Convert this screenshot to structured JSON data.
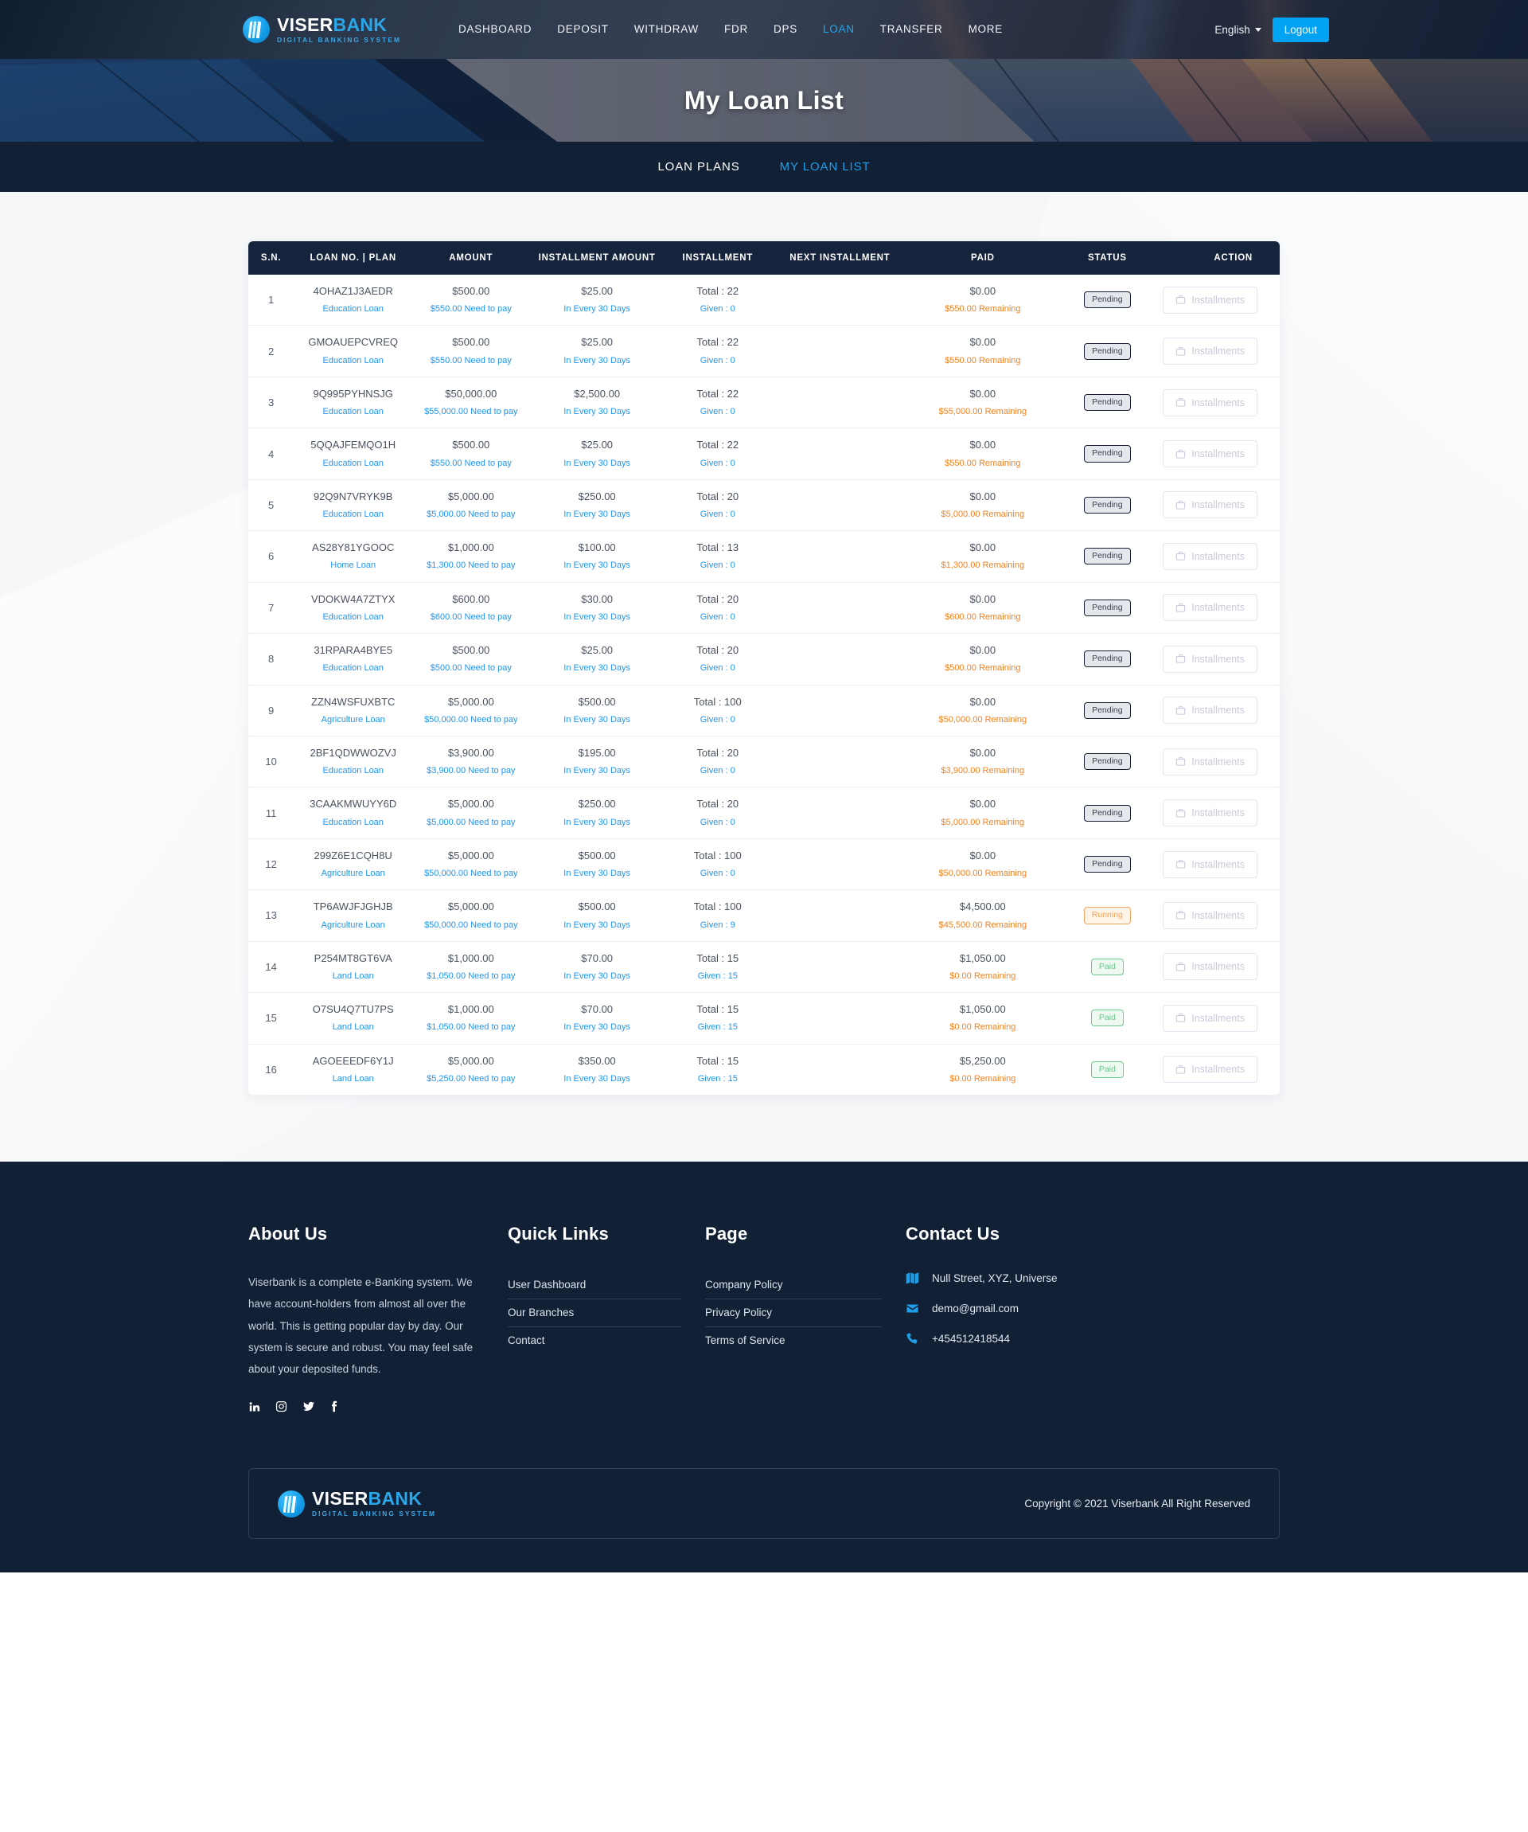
{
  "brand": {
    "name_part1": "VISER",
    "name_part2": "BANK",
    "tagline": "DIGITAL BANKING SYSTEM",
    "accent_color": "#2ba6e8"
  },
  "header": {
    "nav": [
      {
        "label": "DASHBOARD",
        "active": false
      },
      {
        "label": "DEPOSIT",
        "active": false
      },
      {
        "label": "WITHDRAW",
        "active": false
      },
      {
        "label": "FDR",
        "active": false
      },
      {
        "label": "DPS",
        "active": false
      },
      {
        "label": "LOAN",
        "active": true
      },
      {
        "label": "TRANSFER",
        "active": false
      },
      {
        "label": "MORE",
        "active": false
      }
    ],
    "language": "English",
    "logout_label": "Logout"
  },
  "hero": {
    "title": "My Loan List"
  },
  "tabstrip": [
    {
      "label": "LOAN PLANS",
      "active": false
    },
    {
      "label": "MY LOAN LIST",
      "active": true
    }
  ],
  "table": {
    "columns": [
      "S.N.",
      "LOAN NO. | PLAN",
      "AMOUNT",
      "INSTALLMENT AMOUNT",
      "INSTALLMENT",
      "NEXT INSTALLMENT",
      "PAID",
      "STATUS",
      "ACTION"
    ],
    "action_label": "Installments",
    "rows": [
      {
        "sn": "1",
        "loan_no": "4OHAZ1J3AEDR",
        "plan": "Education Loan",
        "amount": "$500.00",
        "need_to_pay": "$550.00 Need to pay",
        "installment_amount": "$25.00",
        "frequency": "In Every 30 Days",
        "total": "Total : 22",
        "given": "Given : 0",
        "next_installment": "",
        "paid": "$0.00",
        "remaining": "$550.00 Remaining",
        "status": "Pending",
        "status_kind": "pending"
      },
      {
        "sn": "2",
        "loan_no": "GMOAUEPCVREQ",
        "plan": "Education Loan",
        "amount": "$500.00",
        "need_to_pay": "$550.00 Need to pay",
        "installment_amount": "$25.00",
        "frequency": "In Every 30 Days",
        "total": "Total : 22",
        "given": "Given : 0",
        "next_installment": "",
        "paid": "$0.00",
        "remaining": "$550.00 Remaining",
        "status": "Pending",
        "status_kind": "pending"
      },
      {
        "sn": "3",
        "loan_no": "9Q995PYHNSJG",
        "plan": "Education Loan",
        "amount": "$50,000.00",
        "need_to_pay": "$55,000.00 Need to pay",
        "installment_amount": "$2,500.00",
        "frequency": "In Every 30 Days",
        "total": "Total : 22",
        "given": "Given : 0",
        "next_installment": "",
        "paid": "$0.00",
        "remaining": "$55,000.00 Remaining",
        "status": "Pending",
        "status_kind": "pending"
      },
      {
        "sn": "4",
        "loan_no": "5QQAJFEMQO1H",
        "plan": "Education Loan",
        "amount": "$500.00",
        "need_to_pay": "$550.00 Need to pay",
        "installment_amount": "$25.00",
        "frequency": "In Every 30 Days",
        "total": "Total : 22",
        "given": "Given : 0",
        "next_installment": "",
        "paid": "$0.00",
        "remaining": "$550.00 Remaining",
        "status": "Pending",
        "status_kind": "pending"
      },
      {
        "sn": "5",
        "loan_no": "92Q9N7VRYK9B",
        "plan": "Education Loan",
        "amount": "$5,000.00",
        "need_to_pay": "$5,000.00 Need to pay",
        "installment_amount": "$250.00",
        "frequency": "In Every 30 Days",
        "total": "Total : 20",
        "given": "Given : 0",
        "next_installment": "",
        "paid": "$0.00",
        "remaining": "$5,000.00 Remaining",
        "status": "Pending",
        "status_kind": "pending"
      },
      {
        "sn": "6",
        "loan_no": "AS28Y81YGOOC",
        "plan": "Home Loan",
        "amount": "$1,000.00",
        "need_to_pay": "$1,300.00 Need to pay",
        "installment_amount": "$100.00",
        "frequency": "In Every 30 Days",
        "total": "Total : 13",
        "given": "Given : 0",
        "next_installment": "",
        "paid": "$0.00",
        "remaining": "$1,300.00 Remaining",
        "status": "Pending",
        "status_kind": "pending"
      },
      {
        "sn": "7",
        "loan_no": "VDOKW4A7ZTYX",
        "plan": "Education Loan",
        "amount": "$600.00",
        "need_to_pay": "$600.00 Need to pay",
        "installment_amount": "$30.00",
        "frequency": "In Every 30 Days",
        "total": "Total : 20",
        "given": "Given : 0",
        "next_installment": "",
        "paid": "$0.00",
        "remaining": "$600.00 Remaining",
        "status": "Pending",
        "status_kind": "pending"
      },
      {
        "sn": "8",
        "loan_no": "31RPARA4BYE5",
        "plan": "Education Loan",
        "amount": "$500.00",
        "need_to_pay": "$500.00 Need to pay",
        "installment_amount": "$25.00",
        "frequency": "In Every 30 Days",
        "total": "Total : 20",
        "given": "Given : 0",
        "next_installment": "",
        "paid": "$0.00",
        "remaining": "$500.00 Remaining",
        "status": "Pending",
        "status_kind": "pending"
      },
      {
        "sn": "9",
        "loan_no": "ZZN4WSFUXBTC",
        "plan": "Agriculture Loan",
        "amount": "$5,000.00",
        "need_to_pay": "$50,000.00 Need to pay",
        "installment_amount": "$500.00",
        "frequency": "In Every 30 Days",
        "total": "Total : 100",
        "given": "Given : 0",
        "next_installment": "",
        "paid": "$0.00",
        "remaining": "$50,000.00 Remaining",
        "status": "Pending",
        "status_kind": "pending"
      },
      {
        "sn": "10",
        "loan_no": "2BF1QDWWOZVJ",
        "plan": "Education Loan",
        "amount": "$3,900.00",
        "need_to_pay": "$3,900.00 Need to pay",
        "installment_amount": "$195.00",
        "frequency": "In Every 30 Days",
        "total": "Total : 20",
        "given": "Given : 0",
        "next_installment": "",
        "paid": "$0.00",
        "remaining": "$3,900.00 Remaining",
        "status": "Pending",
        "status_kind": "pending"
      },
      {
        "sn": "11",
        "loan_no": "3CAAKMWUYY6D",
        "plan": "Education Loan",
        "amount": "$5,000.00",
        "need_to_pay": "$5,000.00 Need to pay",
        "installment_amount": "$250.00",
        "frequency": "In Every 30 Days",
        "total": "Total : 20",
        "given": "Given : 0",
        "next_installment": "",
        "paid": "$0.00",
        "remaining": "$5,000.00 Remaining",
        "status": "Pending",
        "status_kind": "pending"
      },
      {
        "sn": "12",
        "loan_no": "299Z6E1CQH8U",
        "plan": "Agriculture Loan",
        "amount": "$5,000.00",
        "need_to_pay": "$50,000.00 Need to pay",
        "installment_amount": "$500.00",
        "frequency": "In Every 30 Days",
        "total": "Total : 100",
        "given": "Given : 0",
        "next_installment": "",
        "paid": "$0.00",
        "remaining": "$50,000.00 Remaining",
        "status": "Pending",
        "status_kind": "pending"
      },
      {
        "sn": "13",
        "loan_no": "TP6AWJFJGHJB",
        "plan": "Agriculture Loan",
        "amount": "$5,000.00",
        "need_to_pay": "$50,000.00 Need to pay",
        "installment_amount": "$500.00",
        "frequency": "In Every 30 Days",
        "total": "Total : 100",
        "given": "Given : 9",
        "next_installment": "",
        "paid": "$4,500.00",
        "remaining": "$45,500.00 Remaining",
        "status": "Running",
        "status_kind": "running"
      },
      {
        "sn": "14",
        "loan_no": "P254MT8GT6VA",
        "plan": "Land Loan",
        "amount": "$1,000.00",
        "need_to_pay": "$1,050.00 Need to pay",
        "installment_amount": "$70.00",
        "frequency": "In Every 30 Days",
        "total": "Total : 15",
        "given": "Given : 15",
        "next_installment": "",
        "paid": "$1,050.00",
        "remaining": "$0.00 Remaining",
        "status": "Paid",
        "status_kind": "paid"
      },
      {
        "sn": "15",
        "loan_no": "O7SU4Q7TU7PS",
        "plan": "Land Loan",
        "amount": "$1,000.00",
        "need_to_pay": "$1,050.00 Need to pay",
        "installment_amount": "$70.00",
        "frequency": "In Every 30 Days",
        "total": "Total : 15",
        "given": "Given : 15",
        "next_installment": "",
        "paid": "$1,050.00",
        "remaining": "$0.00 Remaining",
        "status": "Paid",
        "status_kind": "paid"
      },
      {
        "sn": "16",
        "loan_no": "AGOEEEDF6Y1J",
        "plan": "Land Loan",
        "amount": "$5,000.00",
        "need_to_pay": "$5,250.00 Need to pay",
        "installment_amount": "$350.00",
        "frequency": "In Every 30 Days",
        "total": "Total : 15",
        "given": "Given : 15",
        "next_installment": "",
        "paid": "$5,250.00",
        "remaining": "$0.00 Remaining",
        "status": "Paid",
        "status_kind": "paid"
      }
    ]
  },
  "footer": {
    "about": {
      "title": "About Us",
      "text": "Viserbank is a complete e-Banking system. We have account-holders from almost all over the world. This is getting popular day by day. Our system is secure and robust. You may feel safe about your deposited funds.",
      "socials": [
        "linkedin-icon",
        "instagram-icon",
        "twitter-icon",
        "facebook-icon"
      ]
    },
    "quick_links": {
      "title": "Quick Links",
      "items": [
        "User Dashboard",
        "Our Branches",
        "Contact"
      ]
    },
    "page": {
      "title": "Page",
      "items": [
        "Company Policy",
        "Privacy Policy",
        "Terms of Service"
      ]
    },
    "contact": {
      "title": "Contact Us",
      "address": "Null Street, XYZ, Universe",
      "email": "demo@gmail.com",
      "phone": "+454512418544"
    },
    "copyright": "Copyright © 2021 Viserbank All Right Reserved"
  }
}
